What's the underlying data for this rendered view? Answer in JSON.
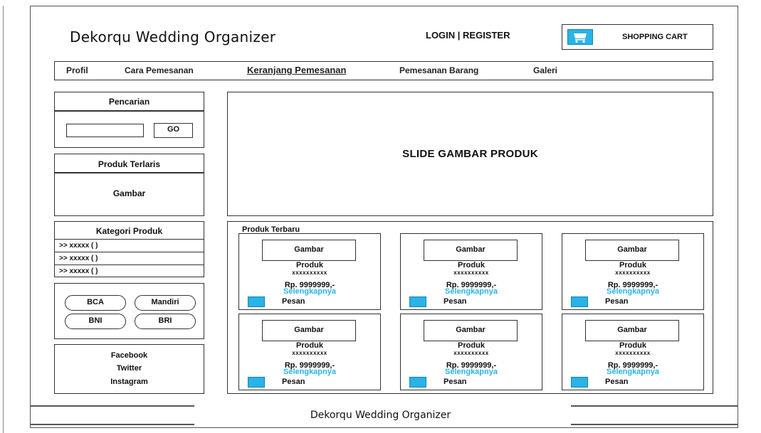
{
  "header": {
    "site_title": "Dekorqu Wedding Organizer",
    "auth_links": "LOGIN | REGISTER",
    "cart_label": "SHOPPING CART",
    "cart_icon": "shopping-cart-icon"
  },
  "nav": {
    "items": [
      {
        "label": "Profil",
        "active": false
      },
      {
        "label": "Cara Pemesanan",
        "active": false
      },
      {
        "label": "Keranjang Pemesanan",
        "active": true
      },
      {
        "label": "Pemesanan Barang",
        "active": false
      },
      {
        "label": "Galeri",
        "active": false
      }
    ]
  },
  "sidebar": {
    "search": {
      "title": "Pencarian",
      "input_value": "",
      "go_label": "GO"
    },
    "best_seller": {
      "title": "Produk Terlaris",
      "image_label": "Gambar"
    },
    "categories": {
      "title": "Kategori Produk",
      "items": [
        ">> xxxxx ( )",
        ">> xxxxx ( )",
        ">> xxxxx ( )"
      ]
    },
    "banks": [
      "BCA",
      "Mandiri",
      "BNI",
      "BRI"
    ],
    "social": [
      "Facebook",
      "Twitter",
      "Instagram"
    ]
  },
  "slider": {
    "label": "SLIDE GAMBAR PRODUK"
  },
  "latest": {
    "title": "Produk Terbaru",
    "products": [
      {
        "image": "Gambar",
        "name": "Produk",
        "code": "xxxxxxxxxx",
        "price": "Rp. 9999999,-",
        "more": "Selengkapnya",
        "order": "Pesan"
      },
      {
        "image": "Gambar",
        "name": "Produk",
        "code": "xxxxxxxxxx",
        "price": "Rp. 9999999,-",
        "more": "Selengkapnya",
        "order": "Pesan"
      },
      {
        "image": "Gambar",
        "name": "Produk",
        "code": "xxxxxxxxxx",
        "price": "Rp. 9999999,-",
        "more": "Selengkapnya",
        "order": "Pesan"
      },
      {
        "image": "Gambar",
        "name": "Produk",
        "code": "xxxxxxxxxx",
        "price": "Rp. 9999999,-",
        "more": "Selengkapnya",
        "order": "Pesan"
      },
      {
        "image": "Gambar",
        "name": "Produk",
        "code": "xxxxxxxxxx",
        "price": "Rp. 9999999,-",
        "more": "Selengkapnya",
        "order": "Pesan"
      },
      {
        "image": "Gambar",
        "name": "Produk",
        "code": "xxxxxxxxxx",
        "price": "Rp. 9999999,-",
        "more": "Selengkapnya",
        "order": "Pesan"
      }
    ]
  },
  "footer": {
    "text": "Dekorqu Wedding Organizer"
  },
  "colors": {
    "accent": "#29b3e6",
    "border": "#333333"
  }
}
